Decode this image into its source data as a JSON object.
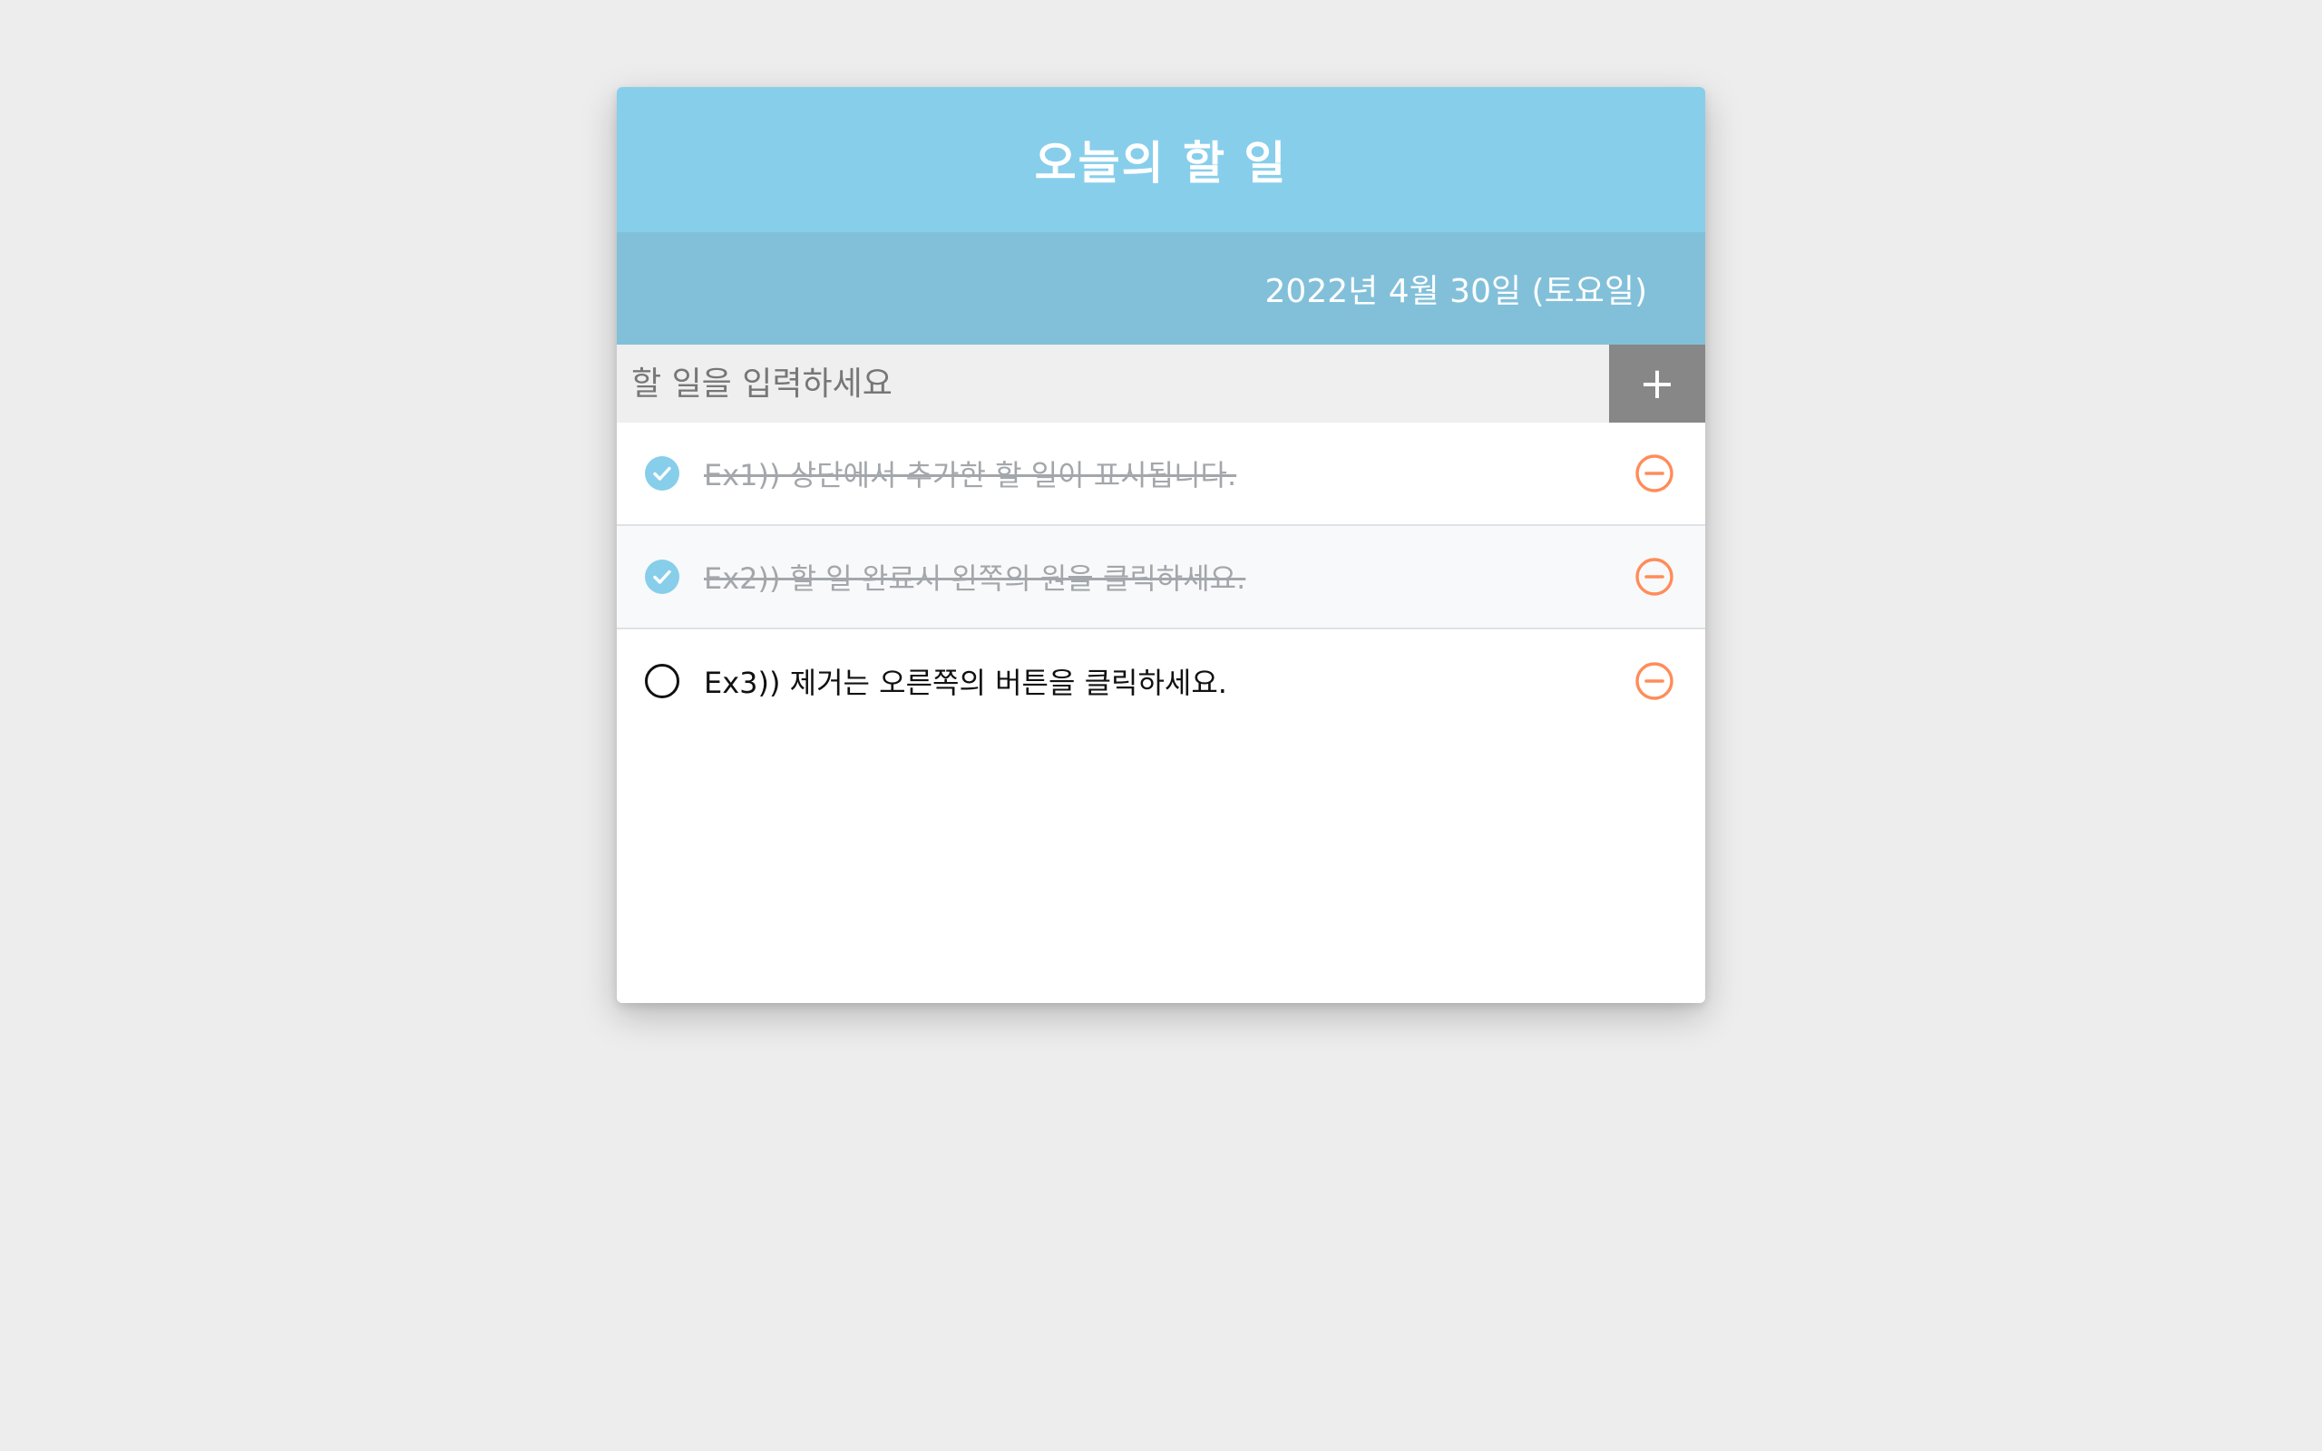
{
  "header": {
    "title": "오늘의 할 일"
  },
  "date_bar": {
    "date": "2022년 4월 30일 (토요일)"
  },
  "input": {
    "placeholder": "할 일을 입력하세요",
    "value": "",
    "add_label": "+"
  },
  "todos": [
    {
      "text": "Ex1)) 상단에서 추가한 할 일이 표시됩니다.",
      "done": true
    },
    {
      "text": "Ex2)) 할 일 완료시 왼쪽의 원을 클릭하세요.",
      "done": true
    },
    {
      "text": "Ex3)) 제거는 오른쪽의 버튼을 클릭하세요.",
      "done": false
    }
  ],
  "icons": {
    "checked": "check-circle-icon",
    "unchecked": "empty-circle-icon",
    "remove": "minus-circle-icon"
  },
  "colors": {
    "background": "#ededed",
    "header": "#87ceeb",
    "date_bar": "#82c0da",
    "check": "#87ceeb",
    "remove": "#ff8c5a",
    "done_text": "#a3a7ab",
    "add_button": "#878787"
  }
}
